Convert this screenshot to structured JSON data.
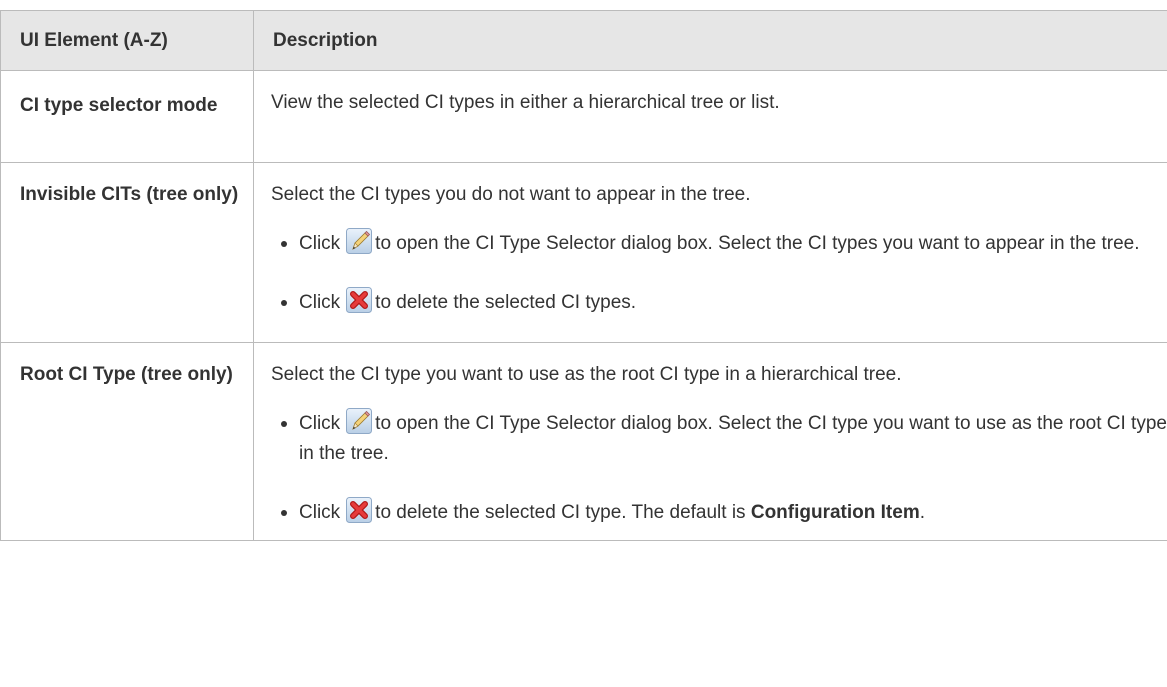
{
  "header": {
    "col1": "UI Element (A-Z)",
    "col2": "Description"
  },
  "rows": [
    {
      "name": "CI type selector mode",
      "description": "View the selected CI types in either a hierarchical tree or list."
    },
    {
      "name": "Invisible CITs (tree only)",
      "intro": "Select the CI types you do not want to appear in the tree.",
      "bullet1": {
        "before": "Click",
        "icon": "pencil-edit-icon",
        "after": "to open the CI Type Selector dialog box. Select the CI types you want to appear in the tree."
      },
      "bullet2": {
        "before": "Click",
        "icon": "red-x-delete-icon",
        "after": "to delete the selected CI types."
      }
    },
    {
      "name": "Root CI Type (tree only)",
      "intro": "Select the CI type you want to use as the root CI type in a hierarchical tree.",
      "bullet1": {
        "before": "Click",
        "icon": "pencil-edit-icon",
        "after": "to open the CI Type Selector dialog box. Select the CI type you want to use as the root CI type in the tree."
      },
      "bullet2": {
        "before": "Click",
        "icon": "red-x-delete-icon",
        "after": "to delete the selected CI type. The default is",
        "bold": "Configuration Item",
        "end": "."
      }
    }
  ]
}
